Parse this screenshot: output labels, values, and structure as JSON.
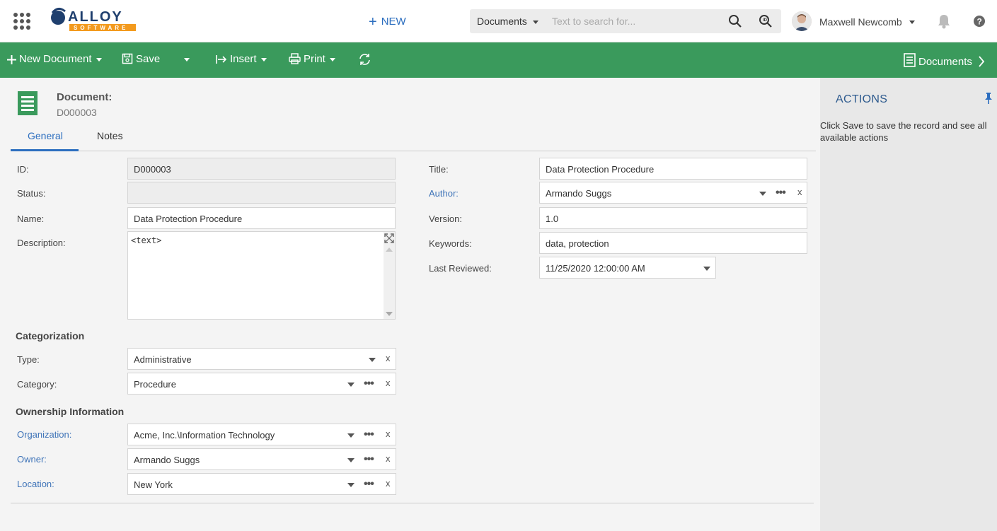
{
  "topbar": {
    "new_label": "NEW",
    "search_scope": "Documents",
    "search_placeholder": "Text to search for...",
    "user_name": "Maxwell Newcomb"
  },
  "toolbar": {
    "new_document": "New Document",
    "save": "Save",
    "insert": "Insert",
    "print": "Print",
    "documents": "Documents"
  },
  "record": {
    "label": "Document:",
    "id": "D000003"
  },
  "tabs": [
    {
      "label": "General",
      "active": true
    },
    {
      "label": "Notes",
      "active": false
    }
  ],
  "left_fields": {
    "id_label": "ID:",
    "id_value": "D000003",
    "status_label": "Status:",
    "status_value": "",
    "name_label": "Name:",
    "name_value": "Data Protection Procedure",
    "description_label": "Description:",
    "description_value": "<text>"
  },
  "right_fields": {
    "title_label": "Title:",
    "title_value": "Data Protection Procedure",
    "author_label": "Author:",
    "author_value": "Armando Suggs",
    "version_label": "Version:",
    "version_value": "1.0",
    "keywords_label": "Keywords:",
    "keywords_value": "data, protection",
    "last_reviewed_label": "Last Reviewed:",
    "last_reviewed_value": "11/25/2020 12:00:00 AM"
  },
  "categorization": {
    "heading": "Categorization",
    "type_label": "Type:",
    "type_value": "Administrative",
    "category_label": "Category:",
    "category_value": "Procedure"
  },
  "ownership": {
    "heading": "Ownership Information",
    "organization_label": "Organization:",
    "organization_value": "Acme, Inc.\\Information Technology",
    "owner_label": "Owner:",
    "owner_value": "Armando Suggs",
    "location_label": "Location:",
    "location_value": "New York"
  },
  "actions_panel": {
    "title": "ACTIONS",
    "message": "Click Save to save the record and see all available actions"
  },
  "colors": {
    "toolbar_green": "#3a9a5c",
    "link_blue": "#3f74b8",
    "accent_blue": "#2c6ebf"
  }
}
